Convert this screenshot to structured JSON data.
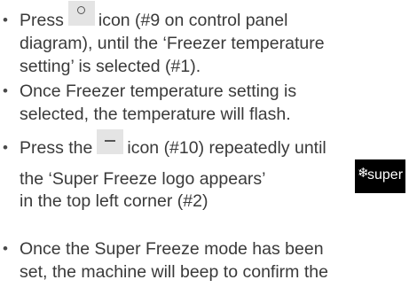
{
  "bullet_char": "•",
  "items": [
    {
      "lines": [
        {
          "before": "Press",
          "icon": "circle-icon",
          "after": "icon (#9 on control panel"
        },
        {
          "text": "diagram), until the ‘Freezer temperature"
        },
        {
          "text": "setting’ is selected (#1)."
        }
      ]
    },
    {
      "lines": [
        {
          "text": "Once Freezer temperature setting is"
        },
        {
          "text": "selected, the temperature will flash."
        }
      ]
    },
    {
      "lines": [
        {
          "before": "Press the",
          "icon": "minus-icon",
          "after": "icon (#10) repeatedly until"
        },
        {
          "text": "the ‘Super Freeze logo appears’"
        },
        {
          "text": "in the top left corner (#2)"
        }
      ]
    },
    {
      "lines": [
        {
          "text": "Once the Super Freeze mode has been"
        },
        {
          "text": "set, the machine will beep to confirm the"
        }
      ]
    }
  ],
  "super_logo": {
    "symbol": "❄",
    "word": "super",
    "icon": "snowflake-icon",
    "background": "#000000",
    "color": "#ffffff"
  },
  "colors": {
    "text": "#3a3a3a",
    "icon_box": "#e4e4e4"
  }
}
